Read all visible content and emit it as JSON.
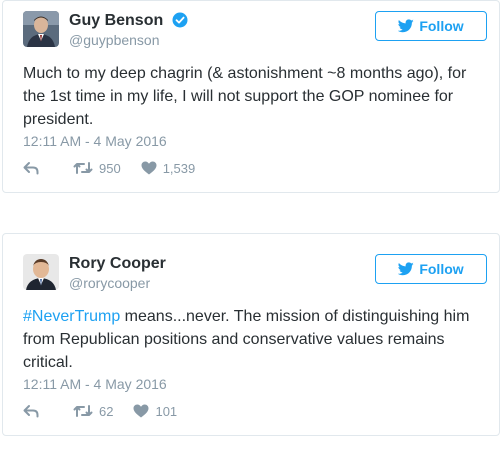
{
  "colors": {
    "accent": "#1da1f2",
    "text": "#292f33",
    "muted": "#8899a6",
    "border": "#e1e8ed"
  },
  "tweets": [
    {
      "author_name": "Guy Benson",
      "verified": true,
      "handle": "@guypbenson",
      "follow_label": "Follow",
      "hashtag": "",
      "text": "Much to my deep chagrin (& astonishment ~8 months ago), for the 1st time in my life, I will not support the GOP nominee for president.",
      "timestamp": "12:11 AM - 4 May 2016",
      "retweets": "950",
      "likes": "1,539",
      "icons": [
        "verified-icon",
        "bird-icon",
        "reply-icon",
        "retweet-icon",
        "heart-icon"
      ]
    },
    {
      "author_name": "Rory Cooper",
      "verified": false,
      "handle": "@rorycooper",
      "follow_label": "Follow",
      "hashtag": "#NeverTrump",
      "text": " means...never. The mission of distinguishing him from Republican positions and conservative values remains critical.",
      "timestamp": "12:11 AM - 4 May 2016",
      "retweets": "62",
      "likes": "101",
      "icons": [
        "bird-icon",
        "reply-icon",
        "retweet-icon",
        "heart-icon"
      ]
    }
  ]
}
